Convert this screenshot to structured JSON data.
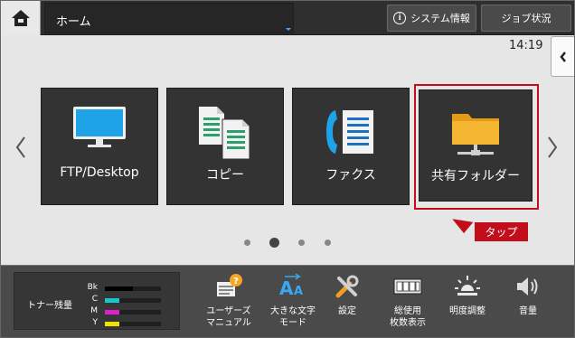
{
  "topbar": {
    "home_icon": "home-icon",
    "title": "ホーム",
    "system_info_label": "システム情報",
    "job_status_label": "ジョブ状況"
  },
  "clock": "14:19",
  "tiles": [
    {
      "label": "FTP/Desktop",
      "icon": "monitor-icon"
    },
    {
      "label": "コピー",
      "icon": "copy-documents-icon"
    },
    {
      "label": "ファクス",
      "icon": "fax-phone-icon"
    },
    {
      "label": "共有フォルダー",
      "icon": "shared-folder-icon"
    }
  ],
  "callout": {
    "label": "タップ",
    "color": "#c20e1a"
  },
  "pager": {
    "total": 4,
    "active_index": 1
  },
  "toner": {
    "label": "トナー残量",
    "levels": [
      {
        "name": "Bk",
        "color": "#000000",
        "fraction": 0.5
      },
      {
        "name": "C",
        "color": "#17c6c6",
        "fraction": 0.25
      },
      {
        "name": "M",
        "color": "#e020c8",
        "fraction": 0.25
      },
      {
        "name": "Y",
        "color": "#f0e000",
        "fraction": 0.25
      }
    ]
  },
  "bottom_items": [
    {
      "label": "ユーザーズ\nマニュアル",
      "icon": "user-manual-icon"
    },
    {
      "label": "大きな文字\nモード",
      "icon": "large-text-icon"
    },
    {
      "label": "設定",
      "icon": "settings-tools-icon"
    },
    {
      "label": "総使用\n枚数表示",
      "icon": "counter-icon"
    },
    {
      "label": "明度調整",
      "icon": "brightness-icon"
    },
    {
      "label": "音量",
      "icon": "volume-icon"
    }
  ]
}
